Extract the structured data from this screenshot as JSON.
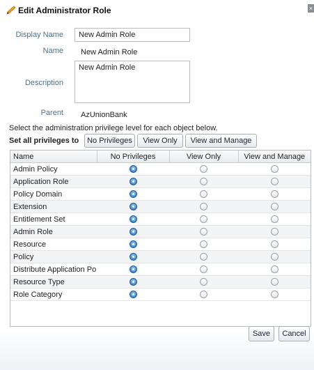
{
  "dialog": {
    "title": "Edit Administrator Role",
    "close_glyph": "×"
  },
  "form": {
    "display_name_label": "Display Name",
    "display_name_value": "New Admin Role",
    "name_label": "Name",
    "name_value": "New Admin Role",
    "description_label": "Description",
    "description_value": "New Admin Role",
    "parent_label": "Parent",
    "parent_value": "AzUnionBank"
  },
  "privileges": {
    "instruction": "Select the administration privilege level for each object below.",
    "set_all_label": "Set all privileges to",
    "set_all_buttons": [
      "No Privileges",
      "View Only",
      "View and Manage"
    ],
    "columns": [
      "Name",
      "No Privileges",
      "View Only",
      "View and Manage"
    ],
    "rows": [
      {
        "name": "Admin Policy",
        "selected": "No Privileges"
      },
      {
        "name": "Application Role",
        "selected": "No Privileges"
      },
      {
        "name": "Policy Domain",
        "selected": "No Privileges"
      },
      {
        "name": "Extension",
        "selected": "No Privileges"
      },
      {
        "name": "Entitlement Set",
        "selected": "No Privileges"
      },
      {
        "name": "Admin Role",
        "selected": "No Privileges"
      },
      {
        "name": "Resource",
        "selected": "No Privileges"
      },
      {
        "name": "Policy",
        "selected": "No Privileges"
      },
      {
        "name": "Distribute Application Policy",
        "selected": "No Privileges"
      },
      {
        "name": "Resource Type",
        "selected": "No Privileges"
      },
      {
        "name": "Role Category",
        "selected": "No Privileges"
      }
    ]
  },
  "footer": {
    "save_label": "Save",
    "cancel_label": "Cancel"
  },
  "icons": {
    "title": "pencil-icon",
    "close": "close-icon"
  },
  "colors": {
    "label": "#4a6f8d",
    "radio_selected": "#3b87d6"
  }
}
